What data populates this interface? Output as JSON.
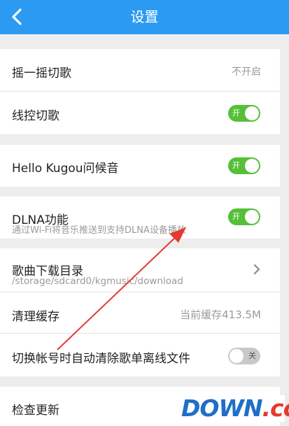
{
  "header": {
    "title": "设置",
    "back_icon": "chevron-left-icon"
  },
  "settings": {
    "shake": {
      "label": "摇一摇切歌",
      "value": "不开启"
    },
    "wire_control": {
      "label": "线控切歌",
      "toggle": "开",
      "state": "on"
    },
    "hello": {
      "label": "Hello Kugou问候音",
      "toggle": "开",
      "state": "on"
    },
    "dlna": {
      "label": "DLNA功能",
      "description": "通过Wi-Fi将音乐推送到支持DLNA设备播放",
      "toggle": "开",
      "state": "on"
    },
    "download_dir": {
      "label": "歌曲下载目录",
      "path": "/storage/sdcard0/kgmusic/download"
    },
    "cache": {
      "label": "清理缓存",
      "value": "当前缓存413.5M"
    },
    "switch_account": {
      "label": "切换帐号时自动清除歌单离线文件",
      "toggle": "关",
      "state": "off"
    },
    "update": {
      "label": "检查更新"
    }
  },
  "watermark": {
    "main": "DOWN",
    "suffix": ".cc"
  },
  "colors": {
    "header": "#2b9af3",
    "toggle_on": "#54c038",
    "toggle_off": "#c9c9c9",
    "annotation_arrow": "#e53a2e"
  }
}
